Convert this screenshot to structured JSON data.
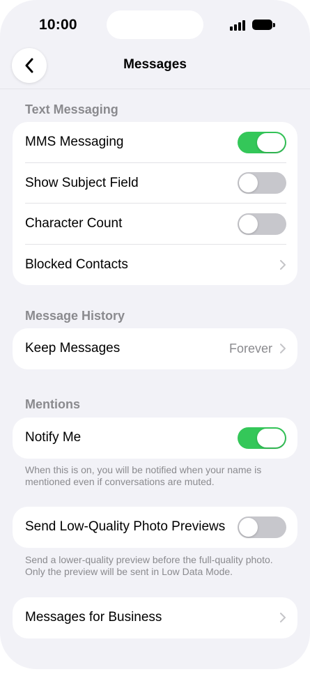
{
  "status_bar": {
    "time": "10:00"
  },
  "nav": {
    "title": "Messages",
    "back_icon": "chevron-left"
  },
  "sections": {
    "text_messaging": {
      "header": "Text Messaging",
      "rows": [
        {
          "label": "MMS Messaging",
          "toggle": true
        },
        {
          "label": "Show Subject Field",
          "toggle": false
        },
        {
          "label": "Character Count",
          "toggle": false
        },
        {
          "label": "Blocked Contacts"
        }
      ]
    },
    "message_history": {
      "header": "Message History",
      "keep_messages": {
        "label": "Keep Messages",
        "value": "Forever"
      }
    },
    "mentions": {
      "header": "Mentions",
      "notify_me": {
        "label": "Notify Me",
        "toggle": true
      },
      "footnote": "When this is on, you will be notified when your name is mentioned even if conversations are muted."
    },
    "low_quality": {
      "label": "Send Low-Quality Photo Previews",
      "toggle": false,
      "footnote": "Send a lower-quality preview before the full-quality photo. Only the preview will be sent in Low Data Mode."
    },
    "business": {
      "label": "Messages for Business"
    }
  },
  "colors": {
    "toggle_on": "#34c759",
    "toggle_off": "#c7c7cc",
    "background": "#f2f2f7",
    "secondary_text": "#8a8a8e"
  }
}
